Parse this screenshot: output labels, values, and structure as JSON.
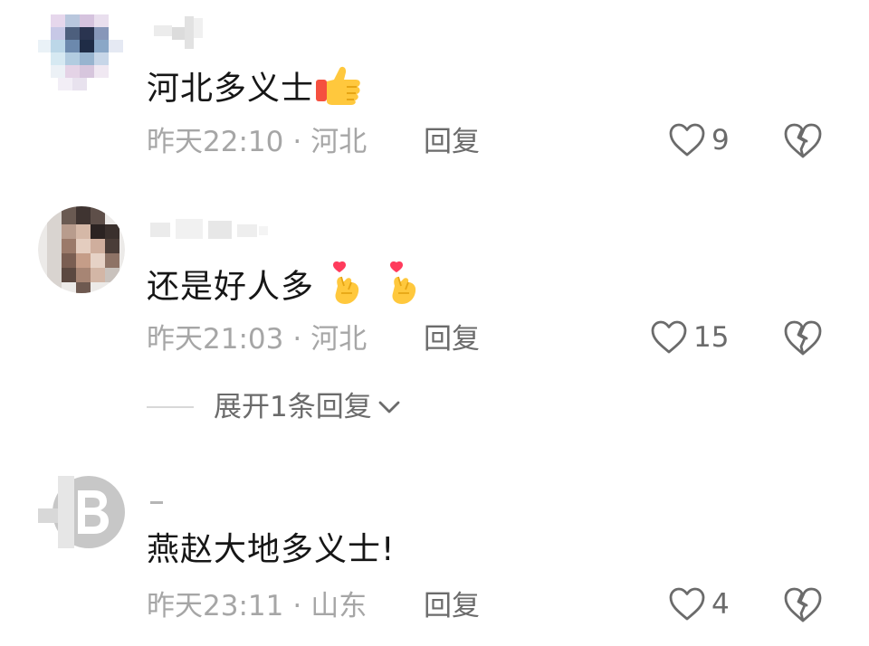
{
  "comments": [
    {
      "text": "河北多义士",
      "emojis": [
        "thumbs-up-icon"
      ],
      "time": "昨天22:10",
      "location": "河北",
      "reply_label": "回复",
      "likes": "9"
    },
    {
      "text": "还是好人多",
      "emojis": [
        "finger-heart-icon",
        "finger-heart-icon"
      ],
      "time": "昨天21:03",
      "location": "河北",
      "reply_label": "回复",
      "likes": "15",
      "expand_label": "展开1条回复"
    },
    {
      "text": "燕赵大地多义士!",
      "emojis": [],
      "time": "昨天23:11",
      "location": "山东",
      "reply_label": "回复",
      "likes": "4"
    }
  ],
  "separator": "·",
  "colors": {
    "text": "#161616",
    "meta": "#a6a6a6",
    "action": "#6b6b6b",
    "heart_red": "#ff3b5c",
    "thumb_yellow": "#ffc83d"
  }
}
